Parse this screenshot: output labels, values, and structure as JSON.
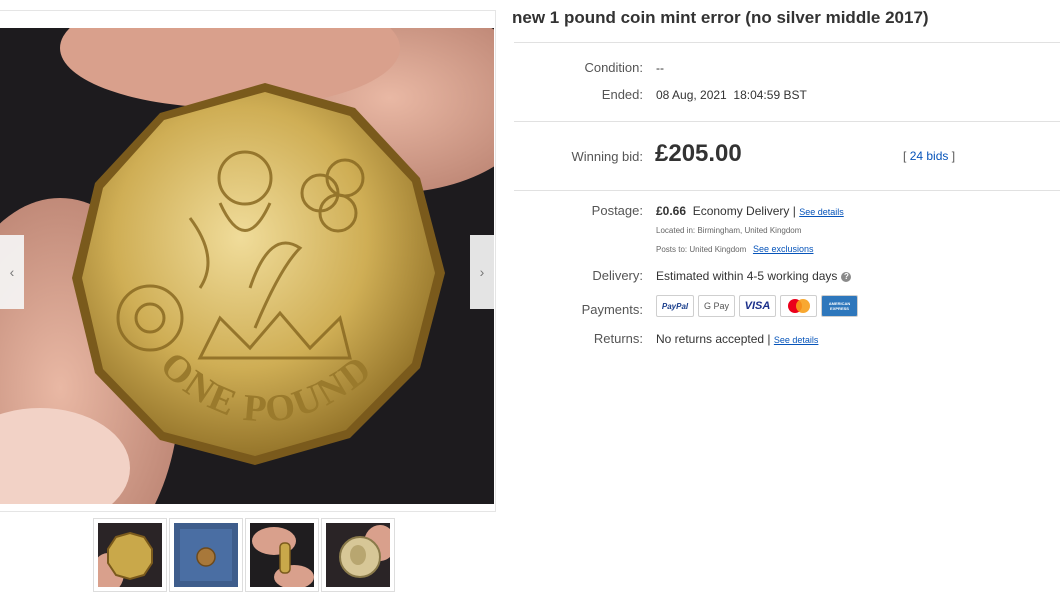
{
  "listing": {
    "title": "new 1 pound coin mint error (no silver middle 2017)"
  },
  "gallery": {
    "coin_text": "ONE POUND",
    "prev_arrow": "‹",
    "next_arrow": "›",
    "thumbnails": [
      "coin front",
      "coin on blue",
      "coin held edge",
      "coin back"
    ]
  },
  "details": {
    "condition_label": "Condition:",
    "condition_value": "--",
    "ended_label": "Ended:",
    "ended_value": "08 Aug, 2021  18:04:59 BST",
    "winning_bid_label": "Winning bid:",
    "winning_bid_value": "£205.00",
    "bids_open": "[",
    "bids_link": "24 bids",
    "bids_close": "]"
  },
  "postage": {
    "label": "Postage:",
    "cost": "£0.66",
    "service": "Economy Delivery",
    "separator": "|",
    "see_details": "See details",
    "located_in": "Located in:  Birmingham, United Kingdom",
    "posts_to": "Posts to:  United Kingdom",
    "see_exclusions": "See exclusions"
  },
  "delivery": {
    "label": "Delivery:",
    "value": "Estimated within 4-5 working days",
    "info_icon": "?"
  },
  "payments": {
    "label": "Payments:",
    "methods": [
      "PayPal",
      "G Pay",
      "VISA",
      "Mastercard",
      "American Express"
    ],
    "paypal_text": "PayPal",
    "gpay_text": "G Pay",
    "visa_text": "VISA",
    "amex_text": "AMERICAN EXPRESS"
  },
  "returns": {
    "label": "Returns:",
    "value": "No returns accepted",
    "separator": "|",
    "see_details": "See details"
  },
  "colors": {
    "link": "#0654ba",
    "coin_gold": "#c9a84a",
    "background_photo": "#1d1b1e"
  }
}
